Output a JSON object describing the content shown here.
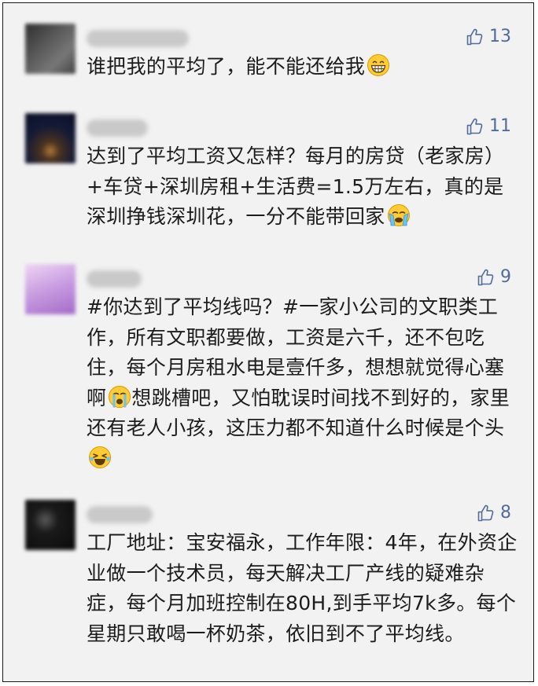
{
  "comments": [
    {
      "likes": "13",
      "text": "谁把我的平均了，能不能还给我",
      "emoji": "grinning-face-icon",
      "avatar_colors": [
        "#3b3b3b",
        "#6b6b6b"
      ]
    },
    {
      "likes": "11",
      "text": "达到了平均工资又怎样？每月的房贷（老家房）+车贷+深圳房租+生活费=1.5万左右，真的是深圳挣钱深圳花，一分不能带回家",
      "emoji": "loudly-crying-face-icon",
      "avatar_colors": [
        "#1b2040",
        "#6a4a2a"
      ]
    },
    {
      "likes": "9",
      "text": "#你达到了平均线吗？#一家小公司的文职类工作，所有文职都要做，工资是六千，还不包吃住，每个月房租水电是壹仟多，想想就觉得心塞啊",
      "text2": "想跳槽吧，又怕耽误时间找不到好的，家里还有老人小孩，这压力都不知道什么时候是个头",
      "emoji_mid": "crying-face-icon",
      "emoji": "tears-of-joy-face-icon",
      "avatar_colors": [
        "#d9b4e6",
        "#b57fd0"
      ]
    },
    {
      "likes": "8",
      "text": "工厂地址：宝安福永，工作年限：4年，在外资企业做一个技术员，每天解决工厂产线的疑难杂症，每个月加班控制在80H,到手平均7k多。每个星期只敢喝一杯奶茶，依旧到不了平均线。",
      "avatar_colors": [
        "#0e0e0e",
        "#3a3a3a"
      ]
    }
  ],
  "colors": {
    "background": "#f2f2f2",
    "like": "#526b9a",
    "text": "#1c1c1c",
    "border": "#1a1a1a"
  }
}
